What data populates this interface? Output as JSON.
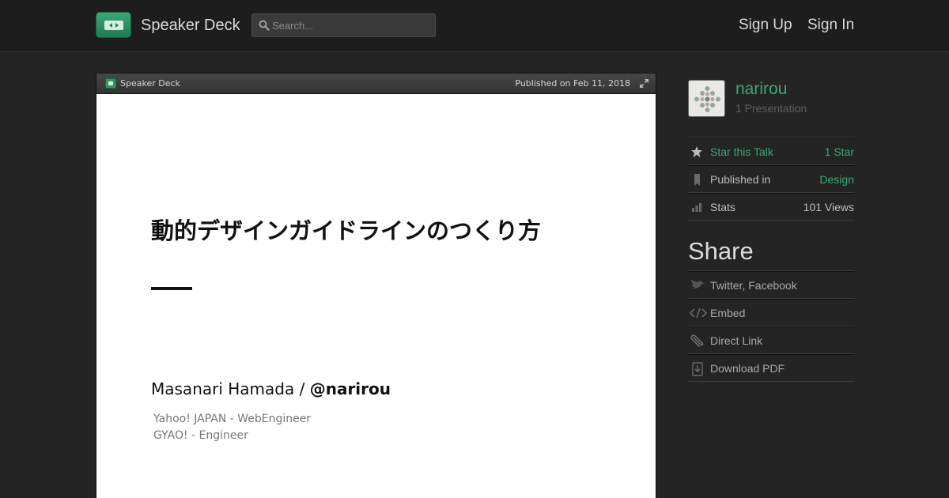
{
  "header": {
    "brand": "Speaker Deck",
    "search_placeholder": "Search...",
    "sign_up": "Sign Up",
    "sign_in": "Sign In"
  },
  "player": {
    "brand": "Speaker Deck",
    "published": "Published on Feb 11, 2018"
  },
  "slide": {
    "title": "動的デザインガイドラインのつくり方",
    "author_name": "Masanari Hamada /",
    "author_handle": "@narirou",
    "role_1": "Yahoo! JAPAN - WebEngineer",
    "role_2": "GYAO! - Engineer"
  },
  "sidebar": {
    "username": "narirou",
    "presentations": "1 Presentation",
    "meta": [
      {
        "label": "Star this Talk",
        "value": "1 Star",
        "icon": "star-icon"
      },
      {
        "label": "Published in",
        "value": "Design",
        "icon": "bookmark-icon"
      },
      {
        "label": "Stats",
        "value": "101 Views",
        "icon": "bar-chart-icon"
      }
    ],
    "share_title": "Share",
    "share": [
      {
        "label": "Twitter, Facebook",
        "icon": "bird-icon"
      },
      {
        "label": "Embed",
        "icon": "code-icon"
      },
      {
        "label": "Direct Link",
        "icon": "paperclip-icon"
      },
      {
        "label": "Download PDF",
        "icon": "download-icon"
      }
    ]
  },
  "colors": {
    "accent": "#3aa877",
    "background": "#242424",
    "header": "#1d1d1d"
  }
}
